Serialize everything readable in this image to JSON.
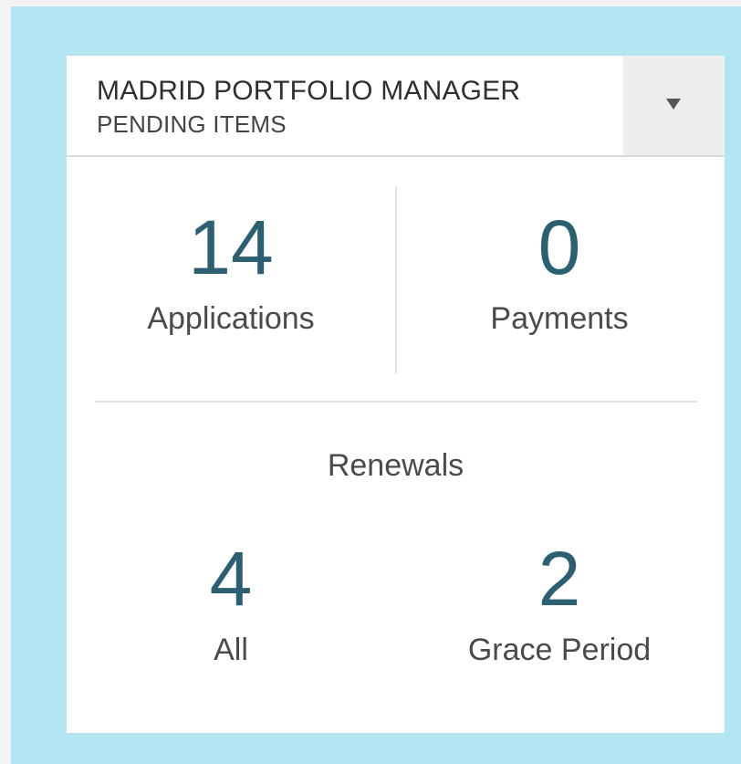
{
  "widget": {
    "title": "MADRID PORTFOLIO MANAGER",
    "subtitle": "PENDING ITEMS",
    "dropdown_icon": "caret-down"
  },
  "stats": {
    "applications": {
      "value": "14",
      "label": "Applications"
    },
    "payments": {
      "value": "0",
      "label": "Payments"
    }
  },
  "renewals": {
    "title": "Renewals",
    "all": {
      "value": "4",
      "label": "All"
    },
    "grace_period": {
      "value": "2",
      "label": "Grace Period"
    }
  },
  "colors": {
    "frame_background": "#b3e4f1",
    "value_text": "#2b6073",
    "header_button": "#eeeeee"
  }
}
